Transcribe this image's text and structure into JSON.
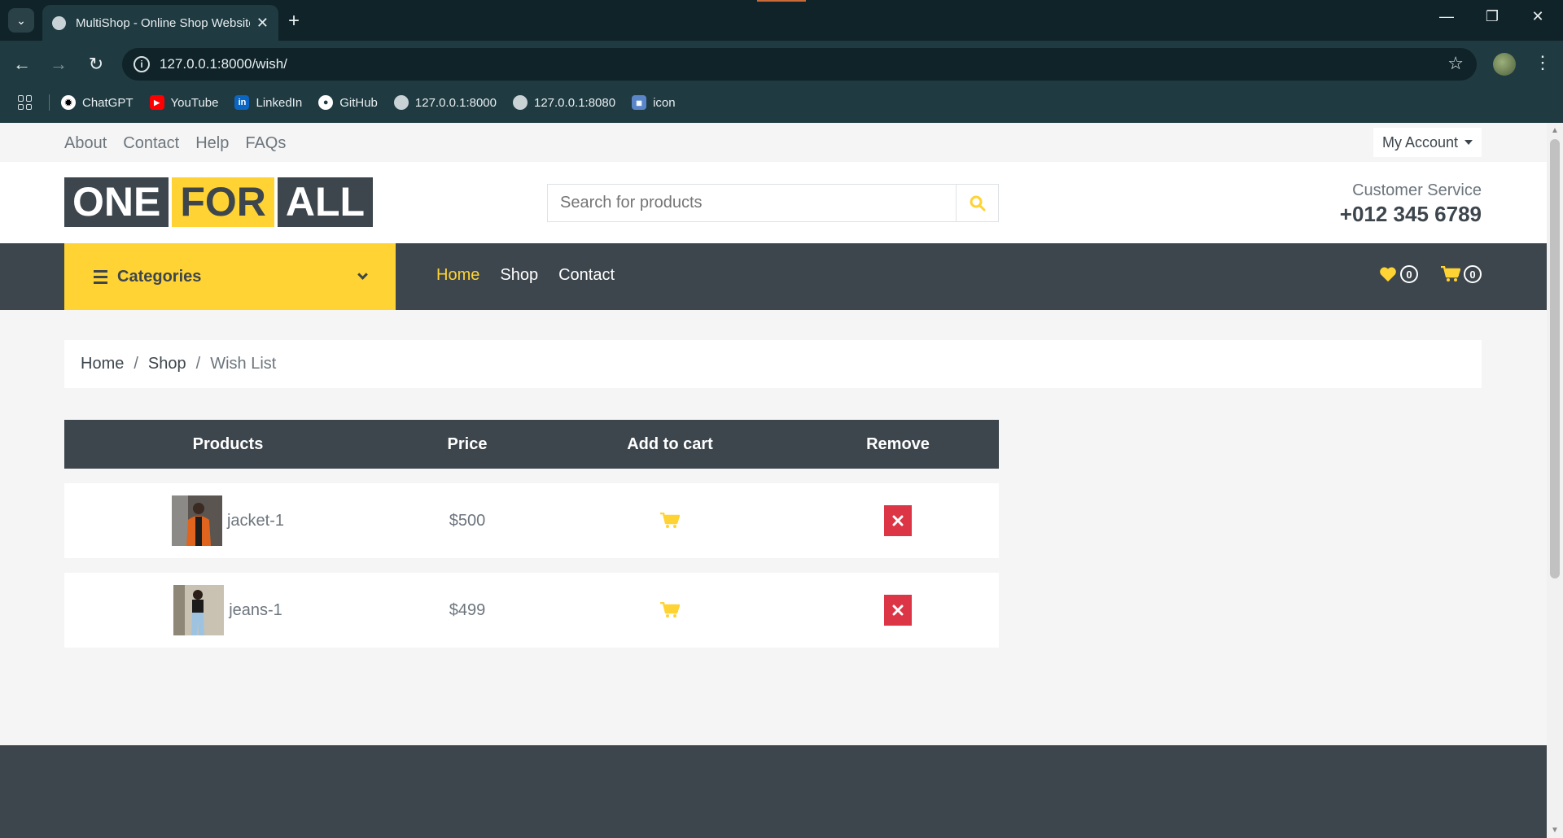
{
  "browser": {
    "tab_title": "MultiShop - Online Shop Website",
    "url": "127.0.0.1:8000/wish/",
    "bookmarks": [
      {
        "label": "ChatGPT",
        "icon": "chatgpt-icon"
      },
      {
        "label": "YouTube",
        "icon": "youtube-icon"
      },
      {
        "label": "LinkedIn",
        "icon": "linkedin-icon"
      },
      {
        "label": "GitHub",
        "icon": "github-icon"
      },
      {
        "label": "127.0.0.1:8000",
        "icon": "globe-icon"
      },
      {
        "label": "127.0.0.1:8080",
        "icon": "globe-icon"
      },
      {
        "label": "icon",
        "icon": "bookmark-app-icon"
      }
    ]
  },
  "topbar": {
    "links": [
      "About",
      "Contact",
      "Help",
      "FAQs"
    ],
    "account_label": "My Account"
  },
  "header": {
    "logo": [
      "ONE",
      "FOR",
      "ALL"
    ],
    "search_placeholder": "Search for products",
    "customer_service_label": "Customer Service",
    "phone": "+012 345 6789"
  },
  "navbar": {
    "categories_label": "Categories",
    "links": [
      "Home",
      "Shop",
      "Contact"
    ],
    "wishlist_count": "0",
    "cart_count": "0"
  },
  "breadcrumb": {
    "items": [
      "Home",
      "Shop"
    ],
    "current": "Wish List"
  },
  "wishlist": {
    "headers": [
      "Products",
      "Price",
      "Add to cart",
      "Remove"
    ],
    "rows": [
      {
        "name": "jacket-1",
        "price": "$500"
      },
      {
        "name": "jeans-1",
        "price": "$499"
      }
    ]
  },
  "colors": {
    "primary": "#ffd333",
    "dark": "#3d464d",
    "danger": "#dc3545"
  }
}
